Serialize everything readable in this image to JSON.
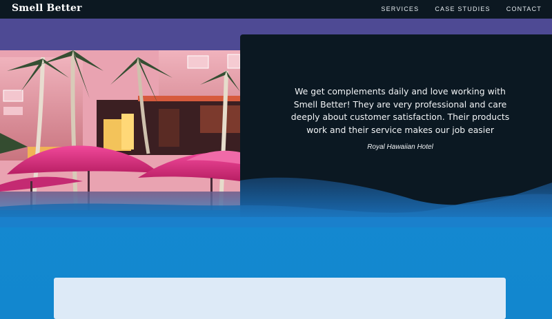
{
  "header": {
    "brand": "Smell Better",
    "nav": [
      {
        "label": "SERVICES"
      },
      {
        "label": "CASE STUDIES"
      },
      {
        "label": "CONTACT"
      }
    ]
  },
  "testimonial": {
    "quote": "We get complements daily and love working with Smell Better! They are very professional and care deeply about customer satisfaction. Their products work and their service makes our job easier",
    "author": "Royal Hawaiian Hotel"
  },
  "colors": {
    "topbar": "#0c1821",
    "purple_band": "#4e4a94",
    "quote_card": "#0b1822",
    "blue": "#1385cc",
    "umbrella_pink": "#e2317f"
  }
}
